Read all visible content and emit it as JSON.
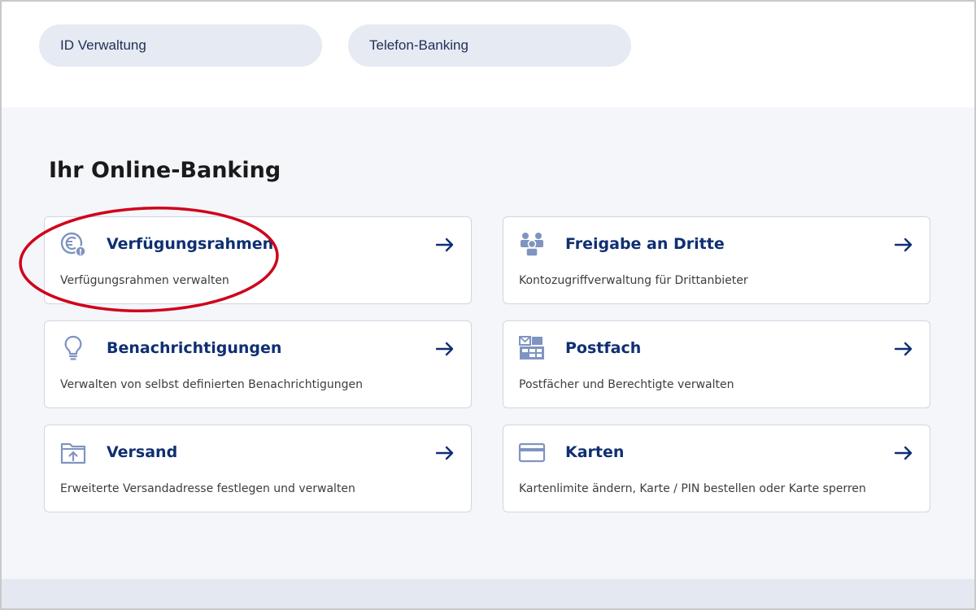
{
  "top_links": [
    {
      "label": "ID Verwaltung"
    },
    {
      "label": "Telefon-Banking"
    }
  ],
  "section": {
    "title": "Ihr Online-Banking"
  },
  "cards": [
    {
      "title": "Verfügungsrahmen",
      "desc": "Verfügungsrahmen verwalten",
      "icon": "euro-info-icon"
    },
    {
      "title": "Freigabe an Dritte",
      "desc": "Kontozugriffverwaltung für Drittanbieter",
      "icon": "people-icon"
    },
    {
      "title": "Benachrichtigungen",
      "desc": "Verwalten von selbst definierten Benachrichtigungen",
      "icon": "lightbulb-icon"
    },
    {
      "title": "Postfach",
      "desc": "Postfächer und Berechtigte verwalten",
      "icon": "mailbox-icon"
    },
    {
      "title": "Versand",
      "desc": "Erweiterte Versandadresse festlegen und verwalten",
      "icon": "folder-upload-icon"
    },
    {
      "title": "Karten",
      "desc": "Kartenlimite ändern, Karte / PIN bestellen oder Karte sperren",
      "icon": "card-icon"
    }
  ],
  "colors": {
    "accent": "#0f2f72",
    "icon": "#7f94c0",
    "highlight": "#d0021b",
    "background": "#f4f6fa"
  }
}
